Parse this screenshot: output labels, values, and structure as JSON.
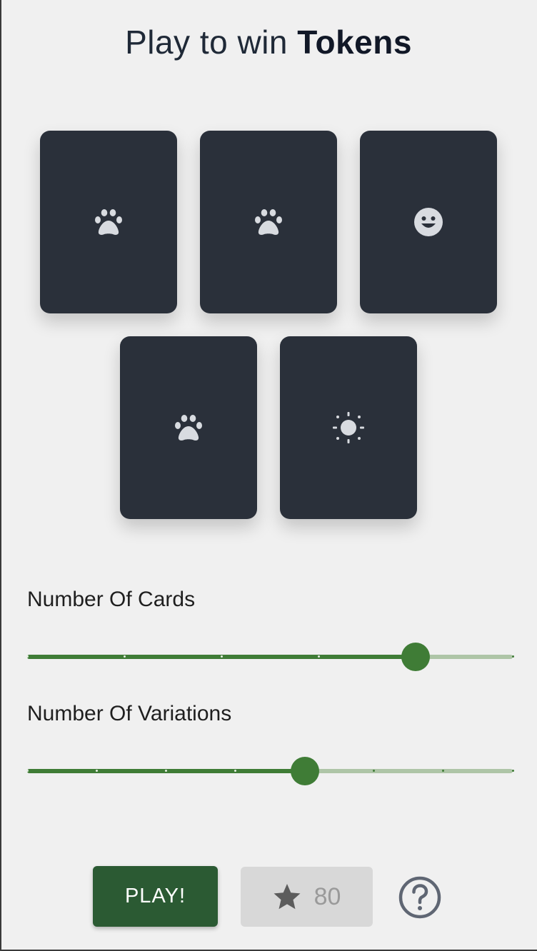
{
  "header": {
    "title_prefix": "Play to win",
    "title_bold": "Tokens"
  },
  "cards": [
    {
      "icon": "paw-icon"
    },
    {
      "icon": "paw-icon"
    },
    {
      "icon": "smiley-icon"
    },
    {
      "icon": "paw-icon"
    },
    {
      "icon": "sun-icon"
    }
  ],
  "sliders": {
    "cards": {
      "label": "Number Of Cards",
      "min": 1,
      "max": 6,
      "value": 5
    },
    "variations": {
      "label": "Number Of Variations",
      "min": 1,
      "max": 8,
      "value": 5
    }
  },
  "actions": {
    "play_label": "PLAY!",
    "cost_value": "80",
    "cost_icon": "star-icon",
    "help_icon": "help-circle-icon"
  },
  "colors": {
    "accent": "#3f7c36",
    "accent_track": "#aec5a7",
    "play_button": "#2b5a33",
    "card_bg": "#2a303a"
  }
}
